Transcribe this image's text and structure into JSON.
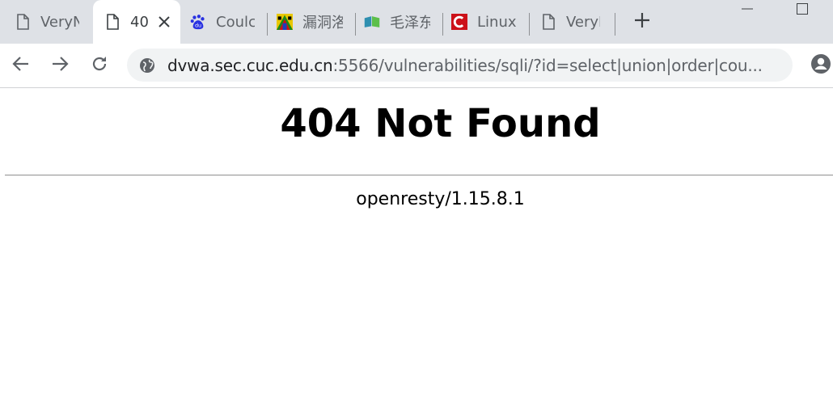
{
  "tabs": [
    {
      "label": "VeryN",
      "icon": "document-icon",
      "active": false
    },
    {
      "label": "40",
      "icon": "document-icon",
      "active": true
    },
    {
      "label": "Coulc",
      "icon": "baidu-icon",
      "active": false
    },
    {
      "label": "漏洞洛",
      "icon": "colorful-logo-icon",
      "active": false
    },
    {
      "label": "毛泽东",
      "icon": "book-icon",
      "active": false
    },
    {
      "label": "Linux",
      "icon": "red-c-icon",
      "active": false
    },
    {
      "label": "VeryN",
      "icon": "document-icon",
      "active": false
    }
  ],
  "address_bar": {
    "host": "dvwa.sec.cuc.edu.cn",
    "rest": ":5566/vulnerabilities/sqli/?id=select|union|order|cou..."
  },
  "page": {
    "title": "404 Not Found",
    "server": "openresty/1.15.8.1"
  }
}
